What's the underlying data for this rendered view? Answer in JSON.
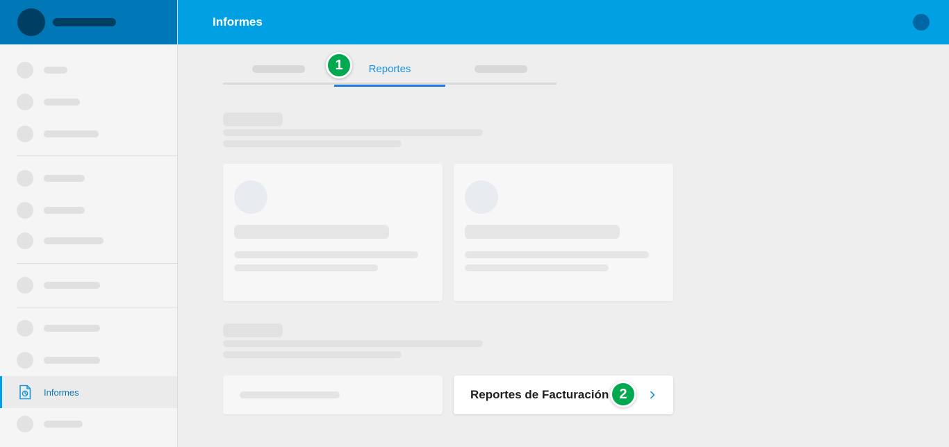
{
  "header": {
    "title": "Informes"
  },
  "sidebar": {
    "active_item": {
      "label": "Informes",
      "icon": "report-document-icon"
    }
  },
  "tabs": {
    "active_label": "Reportes"
  },
  "steps": {
    "step1": "1",
    "step2": "2"
  },
  "link_card": {
    "label": "Reportes de Facturación",
    "icon": "chevron-right-icon"
  },
  "colors": {
    "topbar": "#00a0e3",
    "sidebar_header": "#0077b6",
    "accent": "#1f7fe0",
    "badge": "#00a94f"
  }
}
